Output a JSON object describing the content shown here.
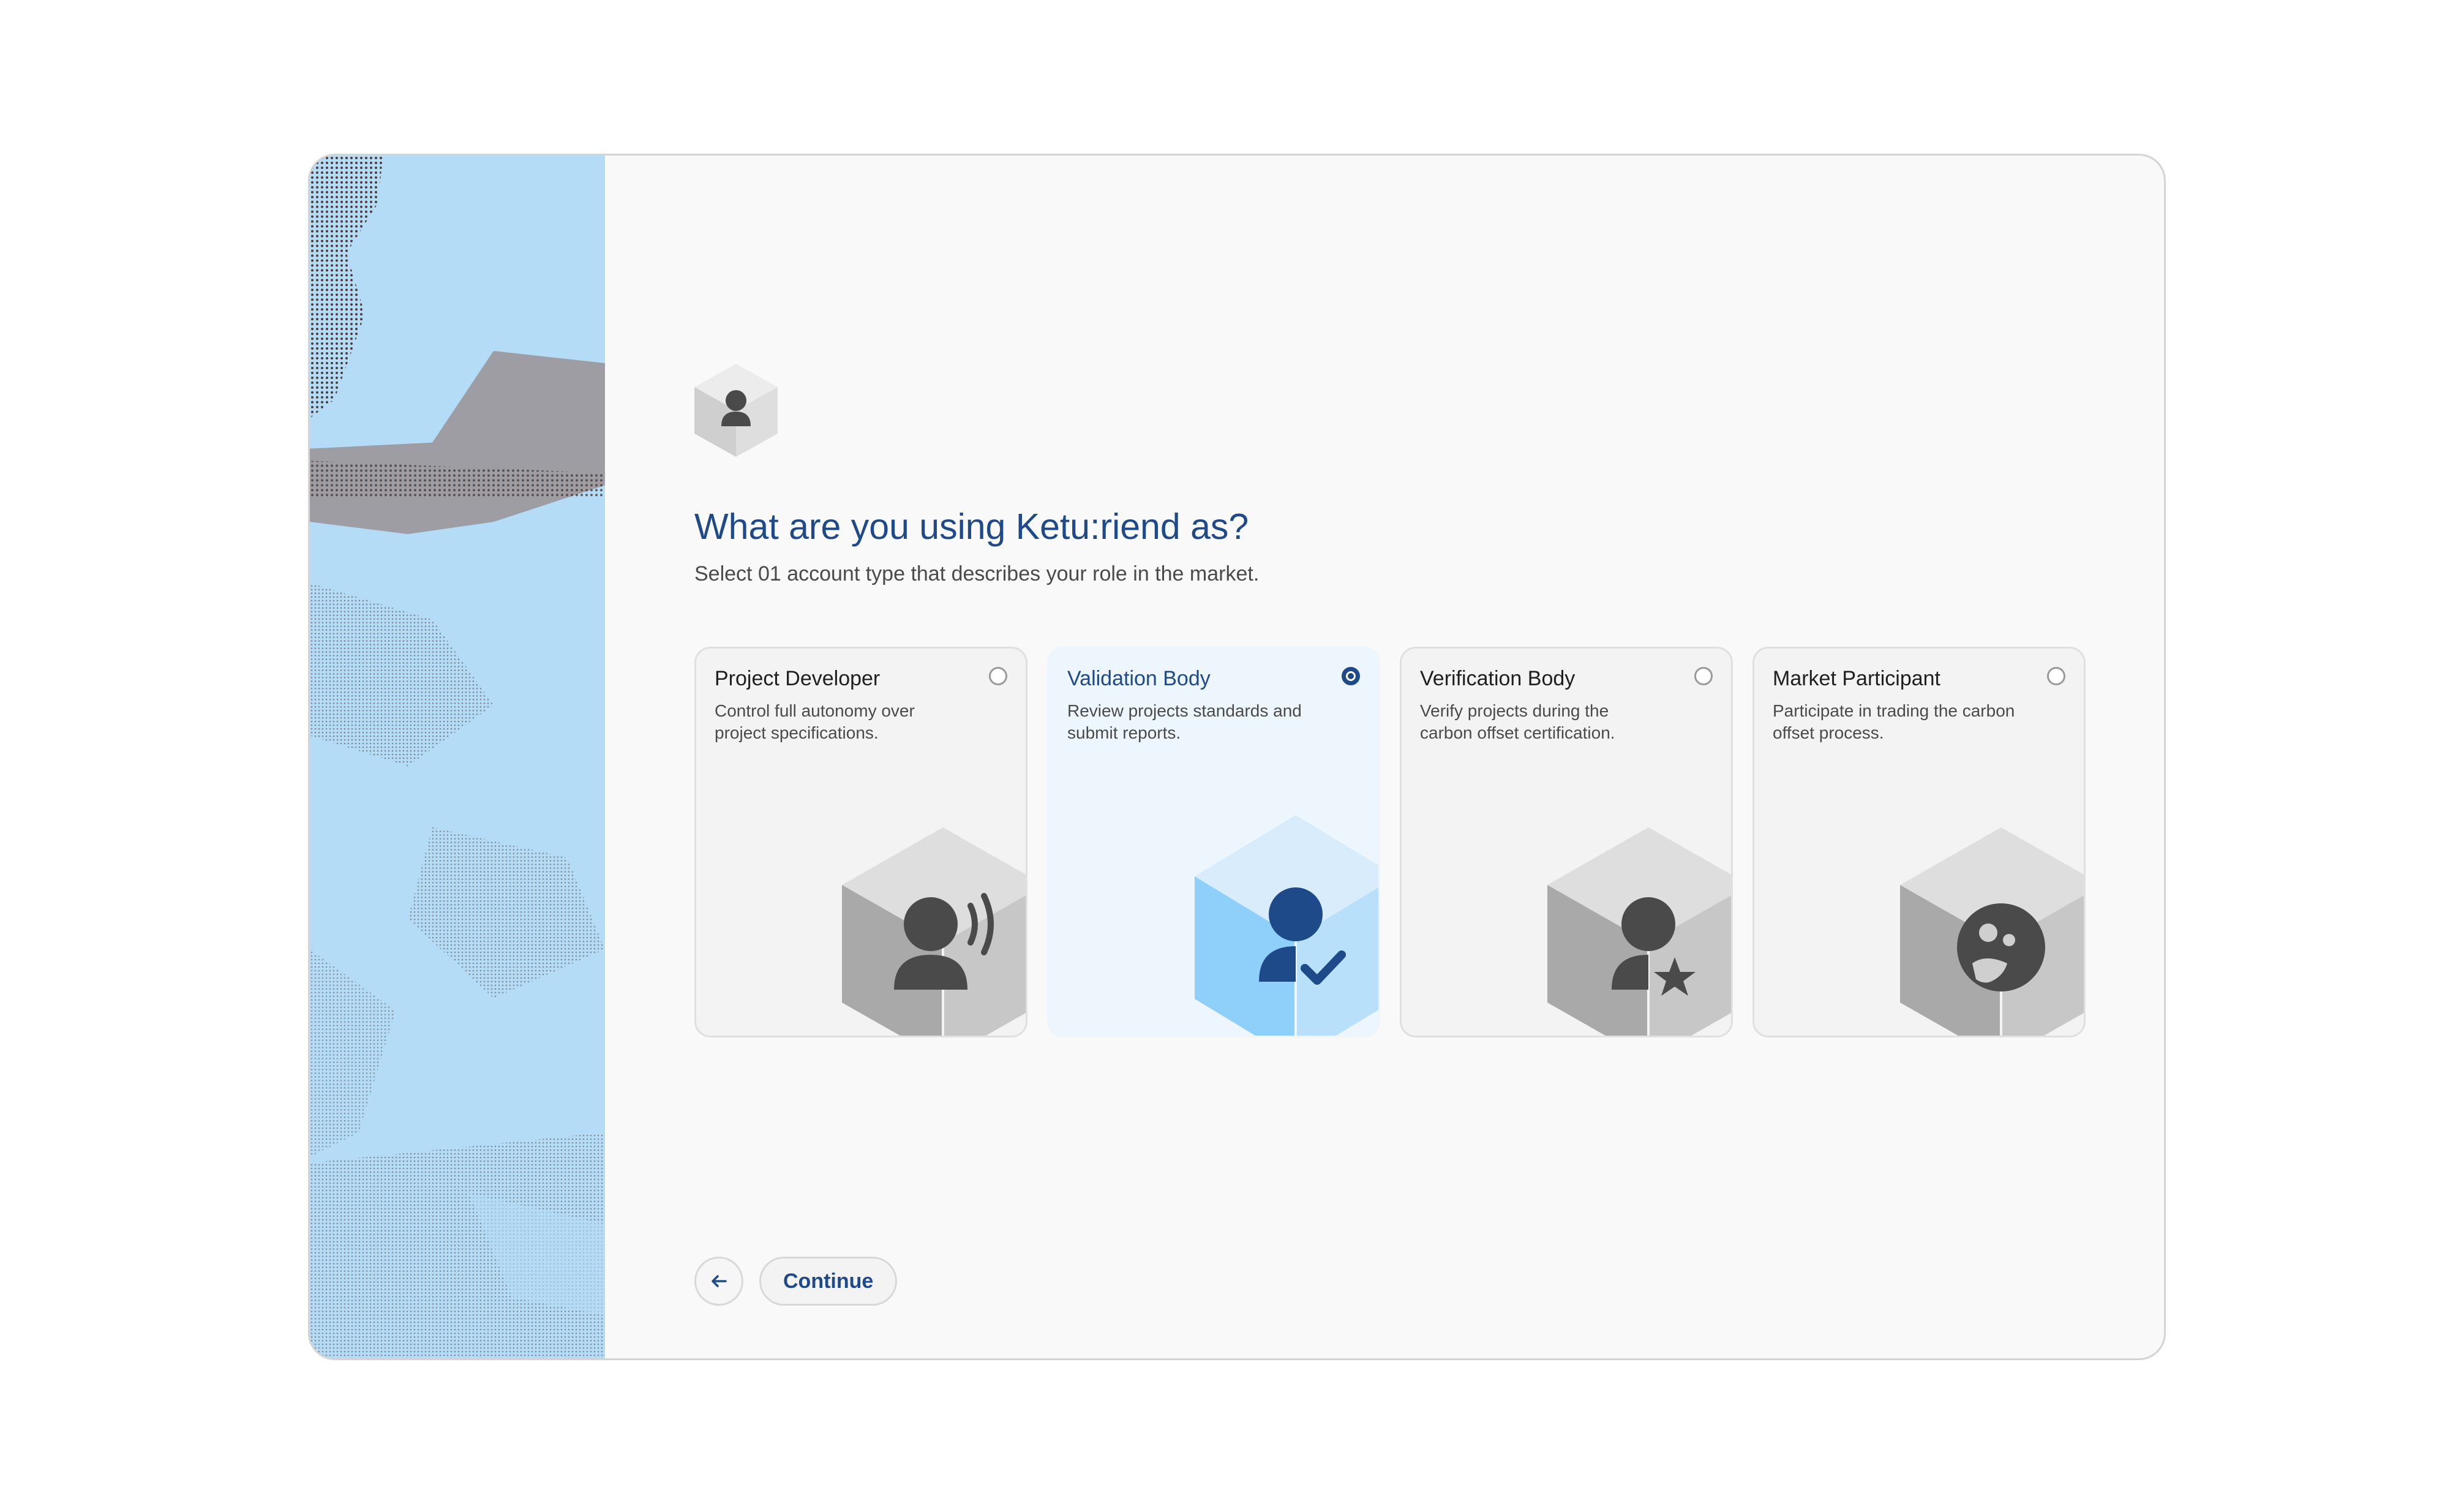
{
  "header": {
    "title": "What are you using Ketu:riend as?",
    "subtitle": "Select 01 account type that describes your role in the market."
  },
  "cards": [
    {
      "title": "Project Developer",
      "description": "Control full autonomy over project specifications.",
      "selected": false,
      "icon": "person-broadcast-icon"
    },
    {
      "title": "Validation Body",
      "description": "Review projects standards and submit reports.",
      "selected": true,
      "icon": "person-check-icon"
    },
    {
      "title": "Verification Body",
      "description": "Verify projects during the carbon offset certification.",
      "selected": false,
      "icon": "person-star-icon"
    },
    {
      "title": "Market Participant",
      "description": "Participate in trading the carbon offset process.",
      "selected": false,
      "icon": "coins-icon"
    }
  ],
  "actions": {
    "back_icon": "arrow-left-icon",
    "continue_label": "Continue"
  },
  "colors": {
    "accent": "#1f4a8a",
    "selected_card_bg": "#eef6fd",
    "card_bg": "#f3f3f3",
    "art_blue": "#b4dcf6",
    "art_brown": "#5a4036"
  }
}
